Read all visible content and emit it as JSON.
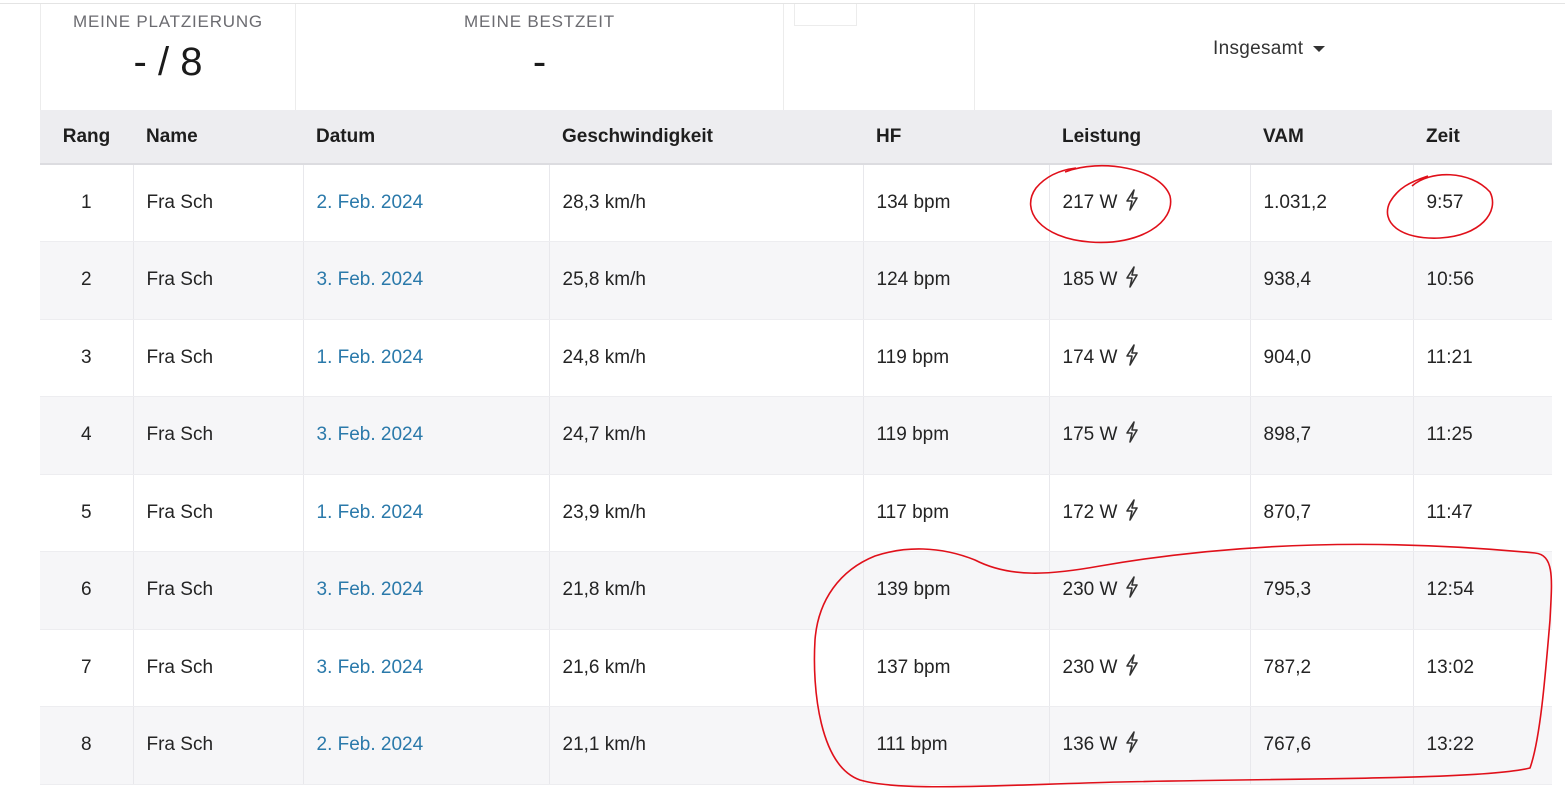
{
  "stats": {
    "placement_label": "MEINE PLATZIERUNG",
    "placement_value": "- / 8",
    "besttime_label": "MEINE BESTZEIT",
    "besttime_value": "-"
  },
  "filter": {
    "selected": "Insgesamt"
  },
  "table": {
    "headers": {
      "rank": "Rang",
      "name": "Name",
      "date": "Datum",
      "speed": "Geschwindigkeit",
      "hr": "HF",
      "power": "Leistung",
      "vam": "VAM",
      "time": "Zeit"
    },
    "rows": [
      {
        "rank": "1",
        "name": "Fra Sch",
        "date": "2. Feb. 2024",
        "speed": "28,3 km/h",
        "hr": "134 bpm",
        "power": "217 W",
        "vam": "1.031,2",
        "time": "9:57"
      },
      {
        "rank": "2",
        "name": "Fra Sch",
        "date": "3. Feb. 2024",
        "speed": "25,8 km/h",
        "hr": "124 bpm",
        "power": "185 W",
        "vam": "938,4",
        "time": "10:56"
      },
      {
        "rank": "3",
        "name": "Fra Sch",
        "date": "1. Feb. 2024",
        "speed": "24,8 km/h",
        "hr": "119 bpm",
        "power": "174 W",
        "vam": "904,0",
        "time": "11:21"
      },
      {
        "rank": "4",
        "name": "Fra Sch",
        "date": "3. Feb. 2024",
        "speed": "24,7 km/h",
        "hr": "119 bpm",
        "power": "175 W",
        "vam": "898,7",
        "time": "11:25"
      },
      {
        "rank": "5",
        "name": "Fra Sch",
        "date": "1. Feb. 2024",
        "speed": "23,9 km/h",
        "hr": "117 bpm",
        "power": "172 W",
        "vam": "870,7",
        "time": "11:47"
      },
      {
        "rank": "6",
        "name": "Fra Sch",
        "date": "3. Feb. 2024",
        "speed": "21,8 km/h",
        "hr": "139 bpm",
        "power": "230 W",
        "vam": "795,3",
        "time": "12:54"
      },
      {
        "rank": "7",
        "name": "Fra Sch",
        "date": "3. Feb. 2024",
        "speed": "21,6 km/h",
        "hr": "137 bpm",
        "power": "230 W",
        "vam": "787,2",
        "time": "13:02"
      },
      {
        "rank": "8",
        "name": "Fra Sch",
        "date": "2. Feb. 2024",
        "speed": "21,1 km/h",
        "hr": "111 bpm",
        "power": "136 W",
        "vam": "767,6",
        "time": "13:22"
      }
    ]
  },
  "icons": {
    "power": "lightning-bolt-icon",
    "dropdown": "caret-down-icon"
  },
  "colors": {
    "link": "#2a79aa",
    "header_bg": "#ededf0",
    "annotation": "#e0101a"
  }
}
